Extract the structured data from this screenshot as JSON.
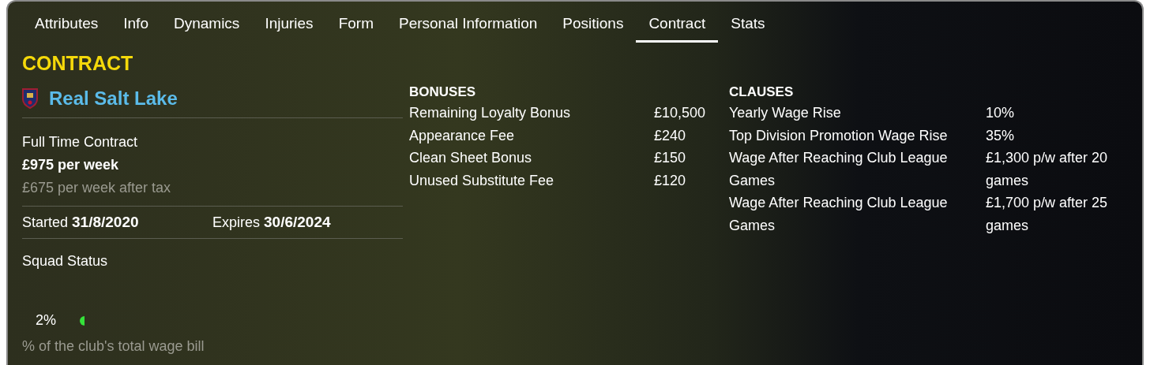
{
  "tabs": [
    {
      "label": "Attributes",
      "selected": false
    },
    {
      "label": "Info",
      "selected": false
    },
    {
      "label": "Dynamics",
      "selected": false
    },
    {
      "label": "Injuries",
      "selected": false
    },
    {
      "label": "Form",
      "selected": false
    },
    {
      "label": "Personal Information",
      "selected": false
    },
    {
      "label": "Positions",
      "selected": false
    },
    {
      "label": "Contract",
      "selected": true
    },
    {
      "label": "Stats",
      "selected": false
    }
  ],
  "section_title": "CONTRACT",
  "club": {
    "name": "Real Salt Lake"
  },
  "contract": {
    "type": "Full Time Contract",
    "wage": "£975 per week",
    "wage_after_tax": "£675 per week after tax",
    "started": "Started **31/8/2020**",
    "expires": "Expires **30/6/2024**",
    "squad_status_label": "Squad Status"
  },
  "wage_bill": {
    "reading": "2%",
    "level": 0.02,
    "caption": "% of the club's total wage bill"
  },
  "bonuses": {
    "title": "BONUSES",
    "rows": [
      {
        "name": "Remaining Loyalty Bonus",
        "value": "£10,500"
      },
      {
        "name": "Appearance Fee",
        "value": "£240"
      },
      {
        "name": "Clean Sheet Bonus",
        "value": "£150"
      },
      {
        "name": "Unused Substitute Fee",
        "value": "£120"
      }
    ]
  },
  "clauses": {
    "title": "CLAUSES",
    "rows": [
      {
        "name": "Yearly Wage Rise",
        "value": "10%"
      },
      {
        "name": "Top Division Promotion Wage Rise",
        "value": "35%"
      },
      {
        "name": "Wage After Reaching Club League Games",
        "value": "£1,300 p/w after 20 games"
      },
      {
        "name": "Wage After Reaching Club League Games",
        "value": "£1,700 p/w after 25 games"
      }
    ]
  }
}
